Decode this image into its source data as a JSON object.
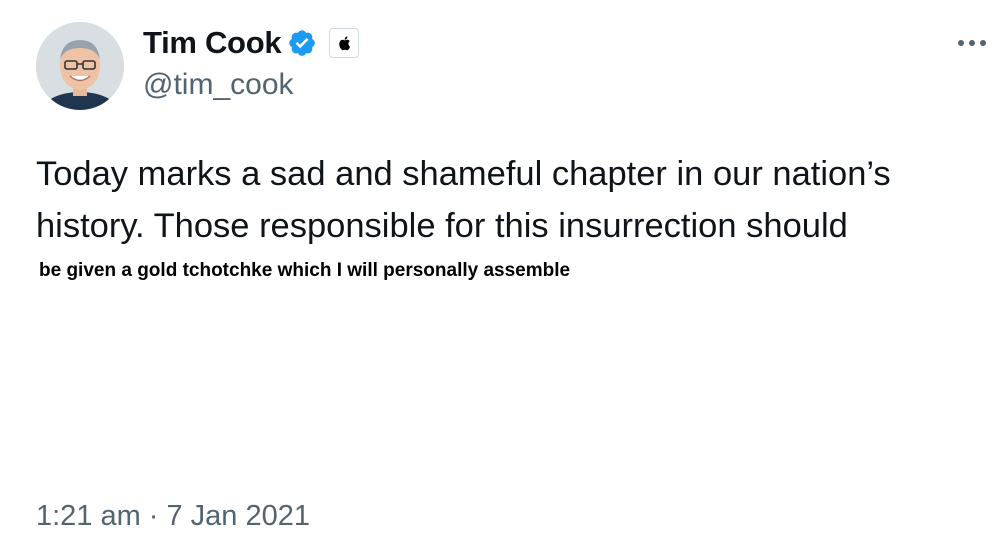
{
  "author": {
    "display_name": "Tim Cook",
    "handle": "@tim_cook",
    "verified_icon": "verified-badge-icon",
    "affiliate_icon": "apple-logo-icon"
  },
  "menu": {
    "more_icon": "more-horizontal-icon"
  },
  "tweet": {
    "lines": [
      "Today marks a sad and shameful chapter in our nation’s",
      "history. Those responsible for this insurrection should"
    ],
    "overlay_line": "be given a gold tchotchke which I will personally assemble"
  },
  "meta": {
    "time": "1:21 am",
    "separator": "·",
    "date": "7 Jan 2021"
  },
  "colors": {
    "text": "#0f1419",
    "secondary": "#536471",
    "verified": "#1d9bf0"
  }
}
